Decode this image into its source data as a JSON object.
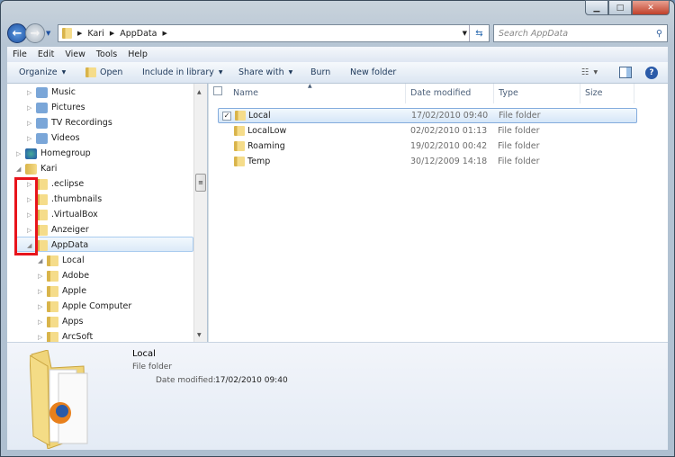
{
  "window": {
    "controls": [
      "minimize",
      "maximize",
      "close"
    ]
  },
  "address": {
    "segments": [
      "Kari",
      "AppData"
    ],
    "search_placeholder": "Search AppData"
  },
  "menu": [
    "File",
    "Edit",
    "View",
    "Tools",
    "Help"
  ],
  "toolbar": {
    "organize": "Organize",
    "open": "Open",
    "include": "Include in library",
    "share": "Share with",
    "burn": "Burn",
    "new_folder": "New folder"
  },
  "tree": [
    {
      "label": "Music",
      "icon": "music-icon",
      "state": "collapsed"
    },
    {
      "label": "Pictures",
      "icon": "pictures-icon",
      "state": "collapsed"
    },
    {
      "label": "TV Recordings",
      "icon": "tv-icon",
      "state": "collapsed"
    },
    {
      "label": "Videos",
      "icon": "video-icon",
      "state": "collapsed"
    },
    {
      "label": "Homegroup",
      "icon": "homegroup-icon",
      "state": "collapsed"
    },
    {
      "label": "Kari",
      "icon": "user-folder-icon",
      "state": "expanded"
    },
    {
      "label": ".eclipse",
      "icon": "folder-icon",
      "state": "collapsed"
    },
    {
      "label": ".thumbnails",
      "icon": "folder-icon",
      "state": "collapsed"
    },
    {
      "label": ".VirtualBox",
      "icon": "folder-icon",
      "state": "collapsed"
    },
    {
      "label": "Anzeiger",
      "icon": "folder-icon",
      "state": "collapsed"
    },
    {
      "label": "AppData",
      "icon": "folder-icon",
      "state": "expanded",
      "selected": true
    },
    {
      "label": "Local",
      "icon": "folder-icon",
      "state": "expanded"
    },
    {
      "label": "Adobe",
      "icon": "folder-icon",
      "state": "collapsed"
    },
    {
      "label": "Apple",
      "icon": "folder-icon",
      "state": "collapsed"
    },
    {
      "label": "Apple Computer",
      "icon": "folder-icon",
      "state": "collapsed"
    },
    {
      "label": "Apps",
      "icon": "folder-icon",
      "state": "collapsed"
    },
    {
      "label": "ArcSoft",
      "icon": "folder-icon",
      "state": "collapsed"
    }
  ],
  "columns": [
    "Name",
    "Date modified",
    "Type",
    "Size"
  ],
  "files": [
    {
      "name": "Local",
      "date": "17/02/2010 09:40",
      "type": "File folder",
      "selected": true
    },
    {
      "name": "LocalLow",
      "date": "02/02/2010 01:13",
      "type": "File folder"
    },
    {
      "name": "Roaming",
      "date": "19/02/2010 00:42",
      "type": "File folder"
    },
    {
      "name": "Temp",
      "date": "30/12/2009 14:18",
      "type": "File folder"
    }
  ],
  "details": {
    "name": "Local",
    "type": "File folder",
    "date_label": "Date modified:",
    "date": "17/02/2010 09:40"
  },
  "colors": {
    "highlight": "#e8141c",
    "selection": "#dceaf8"
  }
}
